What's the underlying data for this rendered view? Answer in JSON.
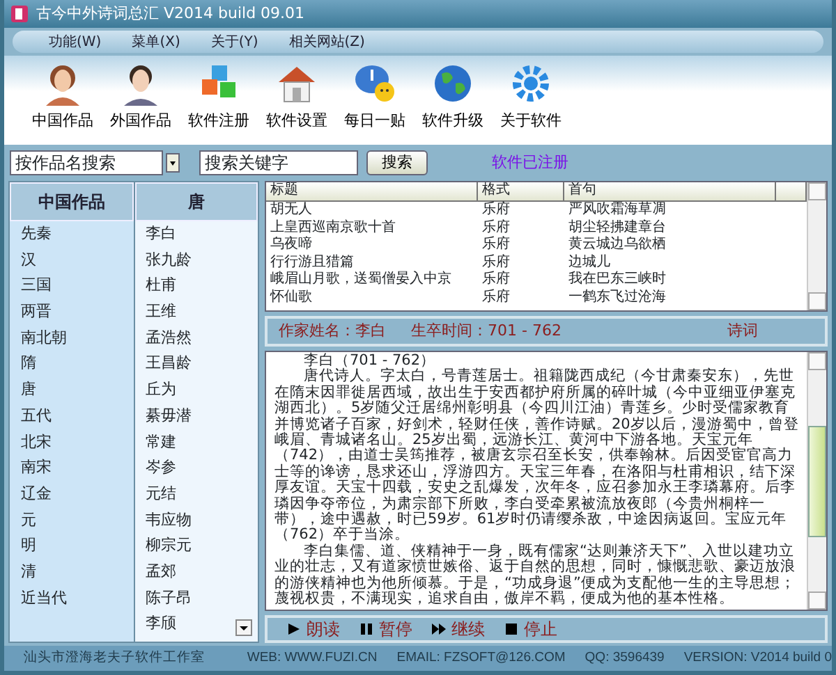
{
  "window": {
    "title": "古今中外诗词总汇 V2014 build 09.01"
  },
  "menu": [
    "功能(W)",
    "菜单(X)",
    "关于(Y)",
    "相关网站(Z)"
  ],
  "toolbar": [
    {
      "kind": "woman",
      "label": "中国作品"
    },
    {
      "kind": "man",
      "label": "外国作品"
    },
    {
      "kind": "cubes",
      "label": "软件注册"
    },
    {
      "kind": "house",
      "label": "软件设置"
    },
    {
      "kind": "chat",
      "label": "每日一贴"
    },
    {
      "kind": "globe",
      "label": "软件升级"
    },
    {
      "kind": "gear",
      "label": "关于软件"
    }
  ],
  "search": {
    "mode": "按作品名搜索",
    "keyword": "搜索关键字",
    "button": "搜索",
    "status": "软件已注册"
  },
  "categories": {
    "heading": "中国作品",
    "items": [
      "先秦",
      "汉",
      "三国",
      "两晋",
      "南北朝",
      "隋",
      "唐",
      "五代",
      "北宋",
      "南宋",
      "辽金",
      "元",
      "明",
      "清",
      "近当代"
    ]
  },
  "authors": {
    "heading": "唐",
    "items": [
      "李白",
      "张九龄",
      "杜甫",
      "王维",
      "孟浩然",
      "王昌龄",
      "丘为",
      "綦毋潜",
      "常建",
      "岑参",
      "元结",
      "韦应物",
      "柳宗元",
      "孟郊",
      "陈子昂",
      "李颀"
    ]
  },
  "poems": {
    "columns": [
      "标题",
      "格式",
      "首句"
    ],
    "rows": [
      [
        "胡无人",
        "乐府",
        "严风吹霜海草凋"
      ],
      [
        "上皇西巡南京歌十首",
        "乐府",
        "胡尘轻拂建章台"
      ],
      [
        "乌夜啼",
        "乐府",
        "黄云城边乌欲栖"
      ],
      [
        "行行游且猎篇",
        "乐府",
        "边城儿"
      ],
      [
        "峨眉山月歌，送蜀僧晏入中京",
        "乐府",
        "我在巴东三峡时"
      ],
      [
        "怀仙歌",
        "乐府",
        "一鹤东飞过沧海"
      ]
    ]
  },
  "author_info": {
    "name": "作家姓名：李白",
    "life": "生卒时间：701 - 762",
    "section": "诗词"
  },
  "biography": [
    "李白（701 - 762）",
    "唐代诗人。字太白，号青莲居士。祖籍陇西成纪（今甘肃秦安东），先世在隋末因罪徙居西域，故出生于安西都护府所属的碎叶城（今中亚细亚伊塞克湖西北）。5岁随父迁居绵州彰明县（今四川江油）青莲乡。少时受儒家教育并博览诸子百家，好剑术，轻财任侠，善作诗赋。20岁以后，漫游蜀中，曾登峨眉、青城诸名山。25岁出蜀，远游长江、黄河中下游各地。天宝元年（742），由道士吴筠推荐，被唐玄宗召至长安，供奉翰林。后因受宦官高力士等的谗谤，恳求还山，浮游四方。天宝三年春，在洛阳与杜甫相识，结下深厚友谊。天宝十四载，安史之乱爆发，次年冬，应召参加永王李璘幕府。后李璘因争夺帝位，为肃宗部下所败，李白受牵累被流放夜郎（今贵州桐梓一带），途中遇赦，时已59岁。61岁时仍请缨杀敌，中途因病返回。宝应元年（762）卒于当涂。",
    "李白集儒、道、侠精神于一身，既有儒家“达则兼济天下”、入世以建功立业的壮志，又有道家愤世嫉俗、返于自然的思想，同时，慷慨悲歌、豪迈放浪的游侠精神也为他所倾慕。于是，“功成身退”便成为支配他一生的主导思想；蔑视权贵，不满现实，追求自由，傲岸不羁，便成为他的基本性格。"
  ],
  "playback": [
    {
      "kind": "play",
      "label": "朗读"
    },
    {
      "kind": "pause",
      "label": "暂停"
    },
    {
      "kind": "forward",
      "label": "继续"
    },
    {
      "kind": "stop",
      "label": "停止"
    }
  ],
  "status_bar": [
    "汕头市澄海老夫子软件工作室",
    "WEB: WWW.FUZI.CN",
    "EMAIL: FZSOFT@126.COM",
    "QQ: 3596439",
    "VERSION: V2014 build 0"
  ]
}
